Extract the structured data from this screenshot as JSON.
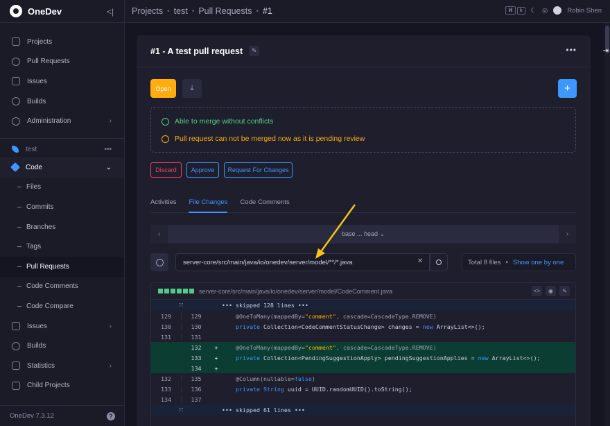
{
  "app": {
    "name": "OneDev",
    "version": "OneDev 7.3.12"
  },
  "sidebar": {
    "top_items": [
      {
        "label": "Projects"
      },
      {
        "label": "Pull Requests"
      },
      {
        "label": "Issues"
      },
      {
        "label": "Builds"
      },
      {
        "label": "Administration"
      }
    ],
    "project": "test",
    "code_label": "Code",
    "code_items": [
      {
        "label": "Files"
      },
      {
        "label": "Commits"
      },
      {
        "label": "Branches"
      },
      {
        "label": "Tags"
      },
      {
        "label": "Pull Requests"
      },
      {
        "label": "Code Comments"
      },
      {
        "label": "Code Compare"
      }
    ],
    "bottom_items": [
      {
        "label": "Issues"
      },
      {
        "label": "Builds"
      },
      {
        "label": "Statistics"
      },
      {
        "label": "Child Projects"
      }
    ]
  },
  "breadcrumb": [
    "Projects",
    "test",
    "Pull Requests",
    "#1"
  ],
  "user": {
    "name": "Robin Shen"
  },
  "topbar_kbd": [
    "⌘",
    "k"
  ],
  "pr": {
    "title": "#1 - A test pull request",
    "open_label": "Open",
    "merge_ok": "Able to merge without conflicts",
    "merge_warn": "Pull request can not be merged now as it is pending review",
    "discard_label": "Discard",
    "approve_label": "Approve",
    "request_changes_label": "Request For Changes"
  },
  "tabs": [
    {
      "label": "Activities",
      "active": false
    },
    {
      "label": "File Changes",
      "active": true
    },
    {
      "label": "Code Comments",
      "active": false
    }
  ],
  "compare": {
    "label": "base ... head"
  },
  "filter": {
    "value": "server-core/src/main/java/io/onedev/server/model/**/*.java"
  },
  "files": {
    "total": "Total 8 files",
    "show_one": "Show one by one"
  },
  "diff": {
    "path": "server-core/src/main/java/io/onedev/server/model/CodeComment.java",
    "skip_top": "••• skipped 128 lines •••",
    "skip_bottom": "••• skipped 61 lines •••"
  },
  "colors": {
    "accent": "#3e97ff",
    "warning": "#ffad0f",
    "success": "#50cd89",
    "danger": "#f1416c"
  }
}
